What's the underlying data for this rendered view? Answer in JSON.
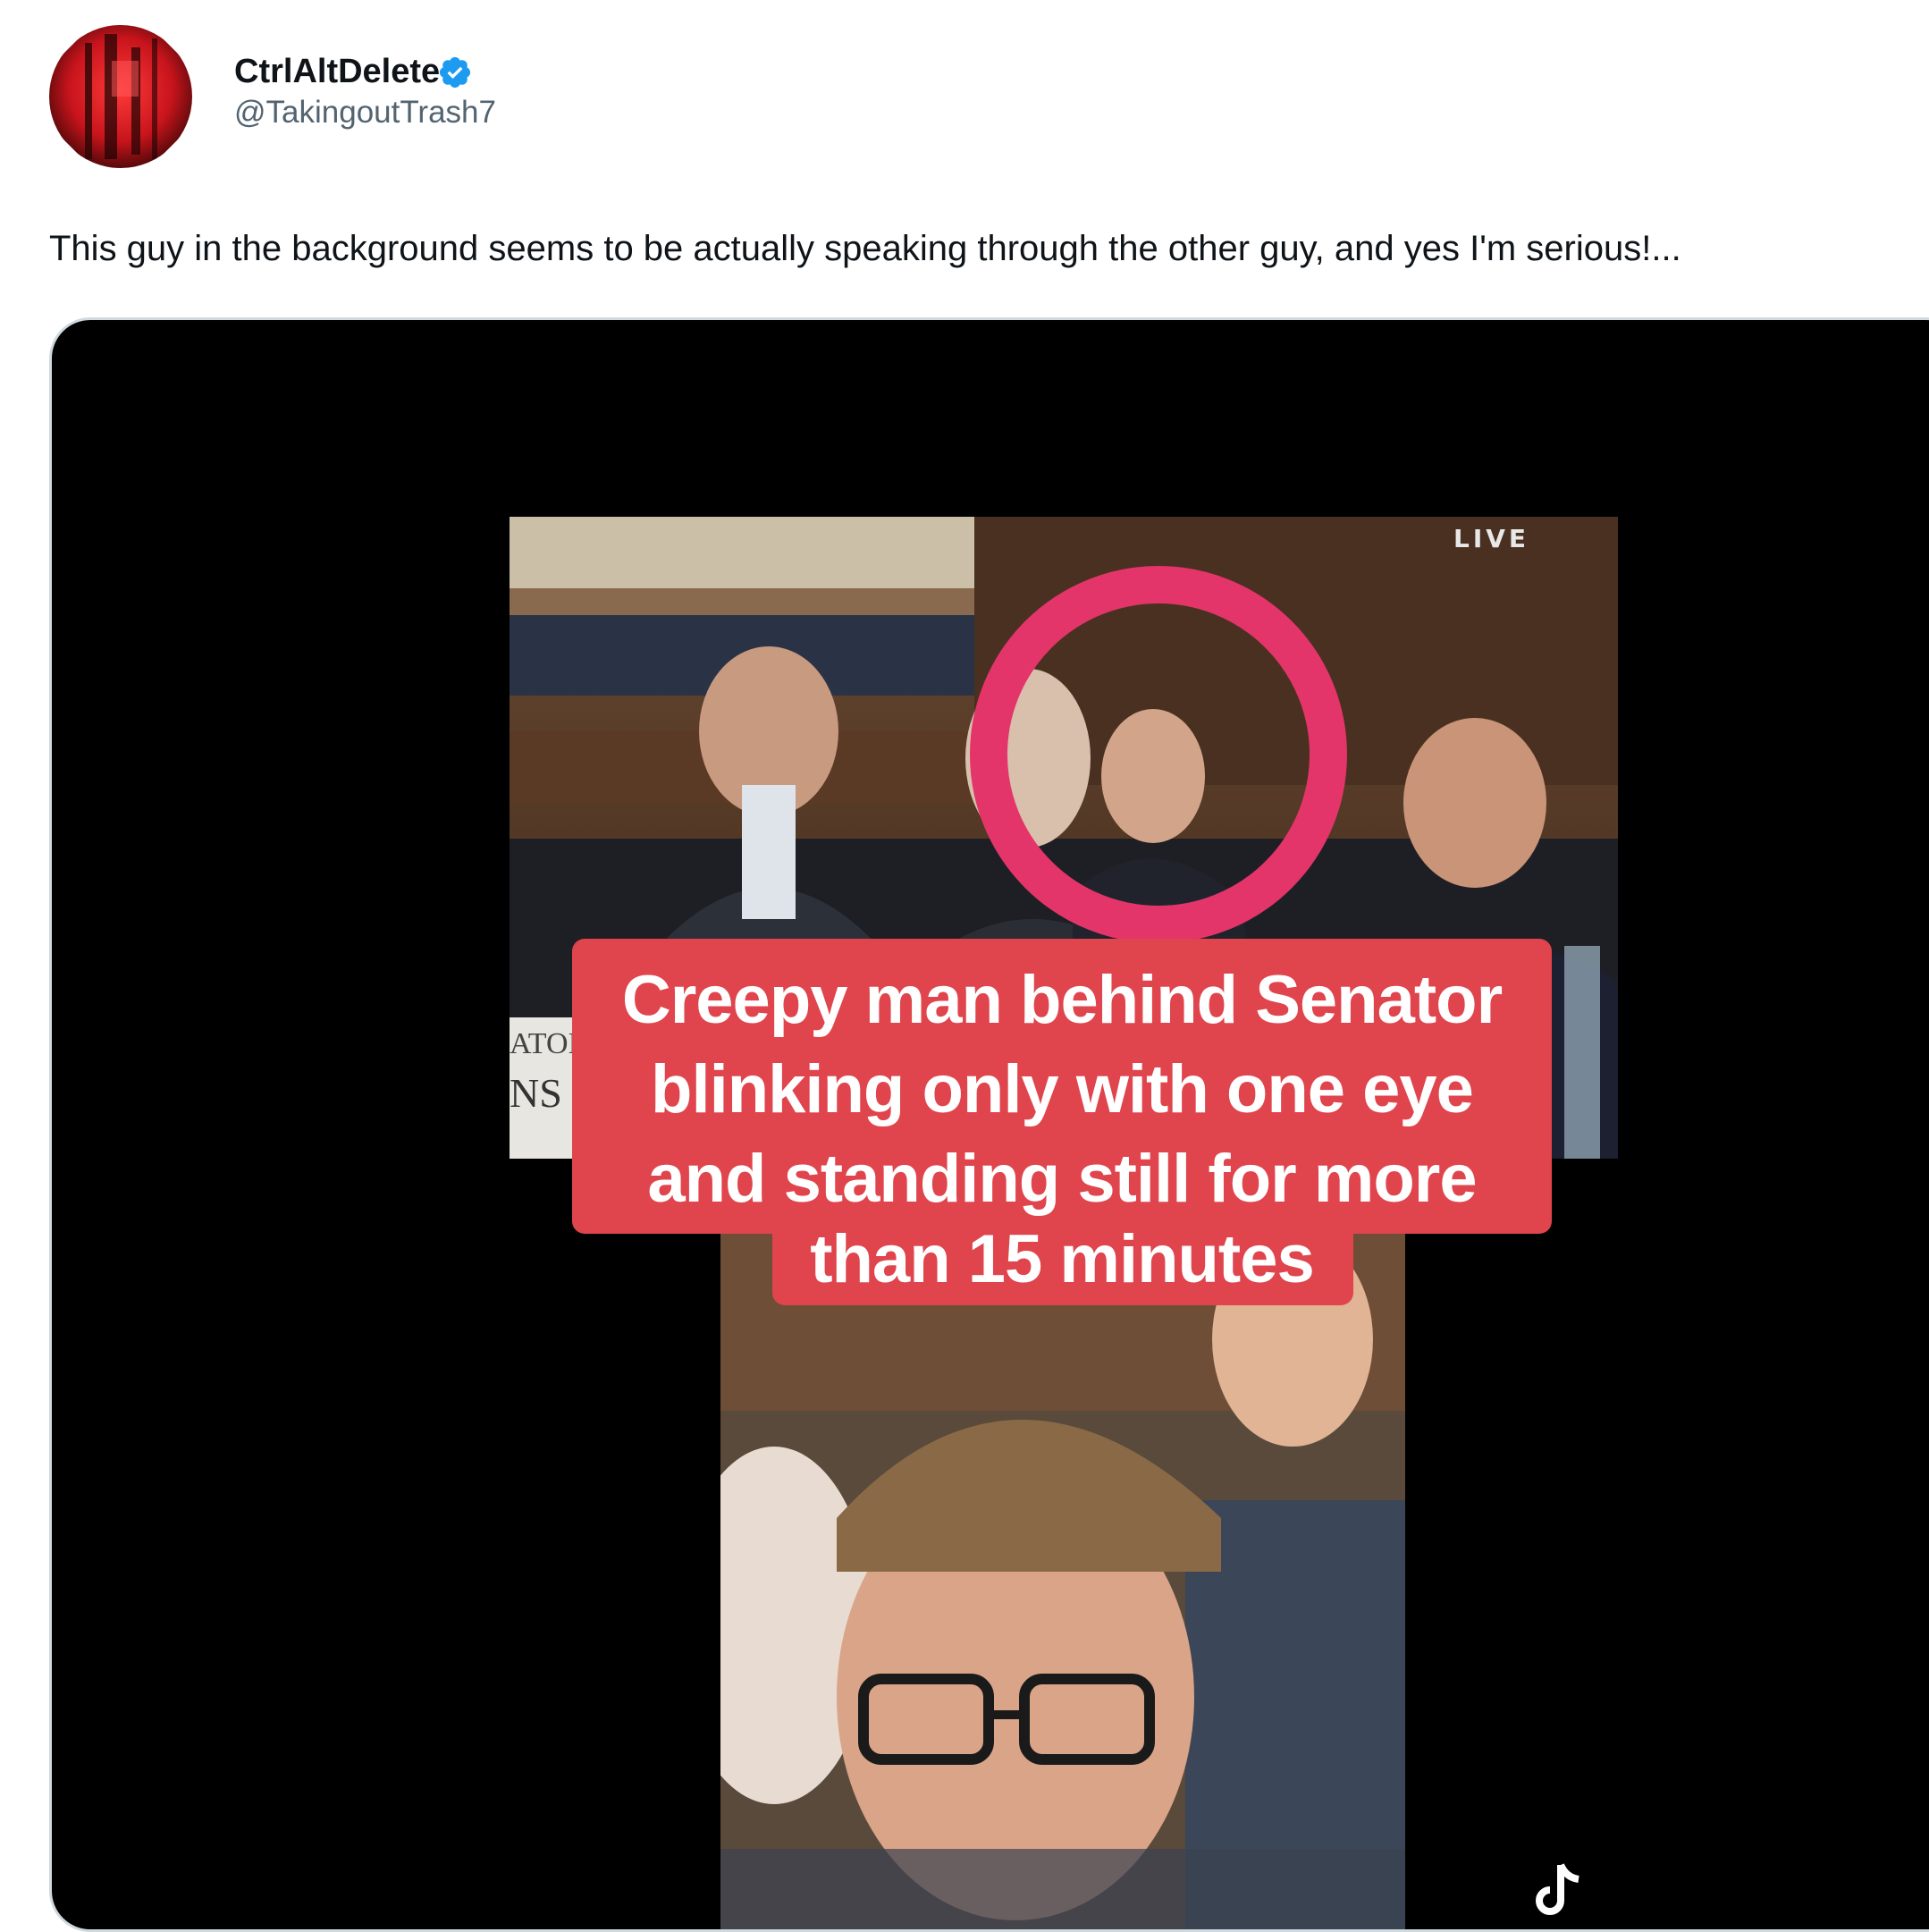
{
  "author": {
    "display_name": "CtrlAltDelete",
    "handle": "@TakingoutTrash7",
    "verified_icon": "verified-badge-icon",
    "avatar_colors": [
      "#c8141c",
      "#2a0505"
    ]
  },
  "tweet": {
    "text": "This guy in the background seems to be actually speaking through the other guy, and yes I'm serious!..."
  },
  "media": {
    "live_label": "LIVE",
    "caption_lines": [
      "Creepy man behind Senator",
      "blinking only with one eye",
      "and standing still for more",
      "than 15 minutes"
    ],
    "caption_color": "#e0444c",
    "highlight_circle_color": "#e3356a",
    "watermark_icon": "tiktok-icon"
  }
}
